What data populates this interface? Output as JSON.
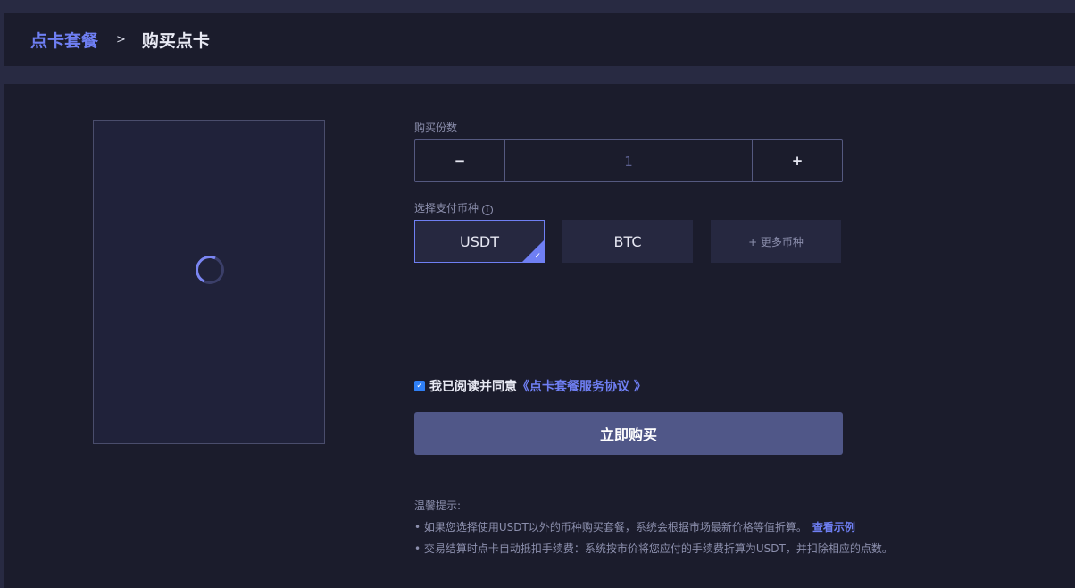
{
  "breadcrumb": {
    "root": "点卡套餐",
    "separator": ">",
    "current": "购买点卡"
  },
  "form": {
    "quantity_label": "购买份数",
    "quantity_minus": "−",
    "quantity_value": "1",
    "quantity_plus": "+",
    "currency_label": "选择支付币种",
    "currency_info_icon": "i",
    "currencies": [
      {
        "label": "USDT",
        "selected": true
      },
      {
        "label": "BTC",
        "selected": false
      }
    ],
    "more_currencies": "+ 更多币种",
    "agree_text": "我已阅读并同意",
    "agree_link": "《点卡套餐服务协议 》",
    "agree_checked": true,
    "buy_button": "立即购买"
  },
  "tips": {
    "title": "温馨提示:",
    "items": [
      "• 如果您选择使用USDT以外的币种购买套餐，系统会根据市场最新价格等值折算。",
      "• 交易结算时点卡自动抵扣手续费：系统按市价将您应付的手续费折算为USDT，并扣除相应的点数。"
    ],
    "example_link": "查看示例"
  },
  "colors": {
    "accent": "#6f7ff3",
    "panel_bg": "#1b1c2c",
    "page_bg": "#282a42",
    "buy_button_bg": "#505788"
  }
}
